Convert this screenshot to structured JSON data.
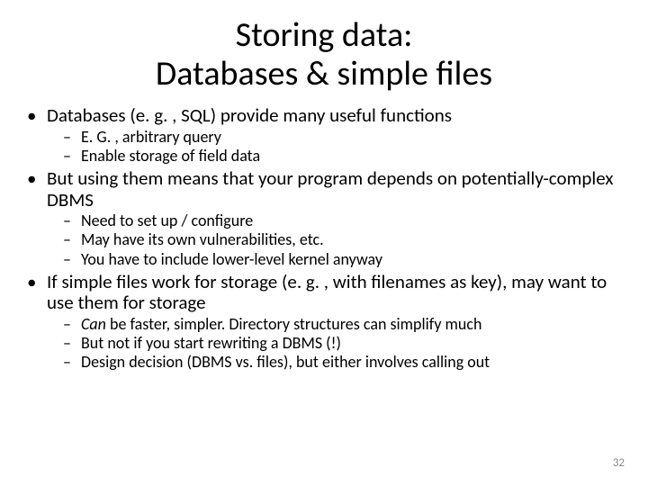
{
  "title_line1": "Storing data:",
  "title_line2": "Databases & simple files",
  "bullets": [
    {
      "text": "Databases (e. g. , SQL) provide many useful functions",
      "sub": [
        "E. G. , arbitrary query",
        "Enable storage of field data"
      ]
    },
    {
      "text": "But using them means that your program depends on potentially-complex DBMS",
      "sub": [
        "Need to set up / configure",
        "May have its own vulnerabilities, etc.",
        "You have to include lower-level kernel anyway"
      ]
    },
    {
      "text": "If simple files work for storage (e. g. , with filenames as key), may want to use them for storage",
      "sub": [
        {
          "italic_lead": "Can",
          "rest": " be faster, simpler. Directory structures can simplify much"
        },
        "But not if you start rewriting a DBMS (!)",
        "Design decision (DBMS vs. files), but either involves calling out"
      ]
    }
  ],
  "page_number": "32"
}
